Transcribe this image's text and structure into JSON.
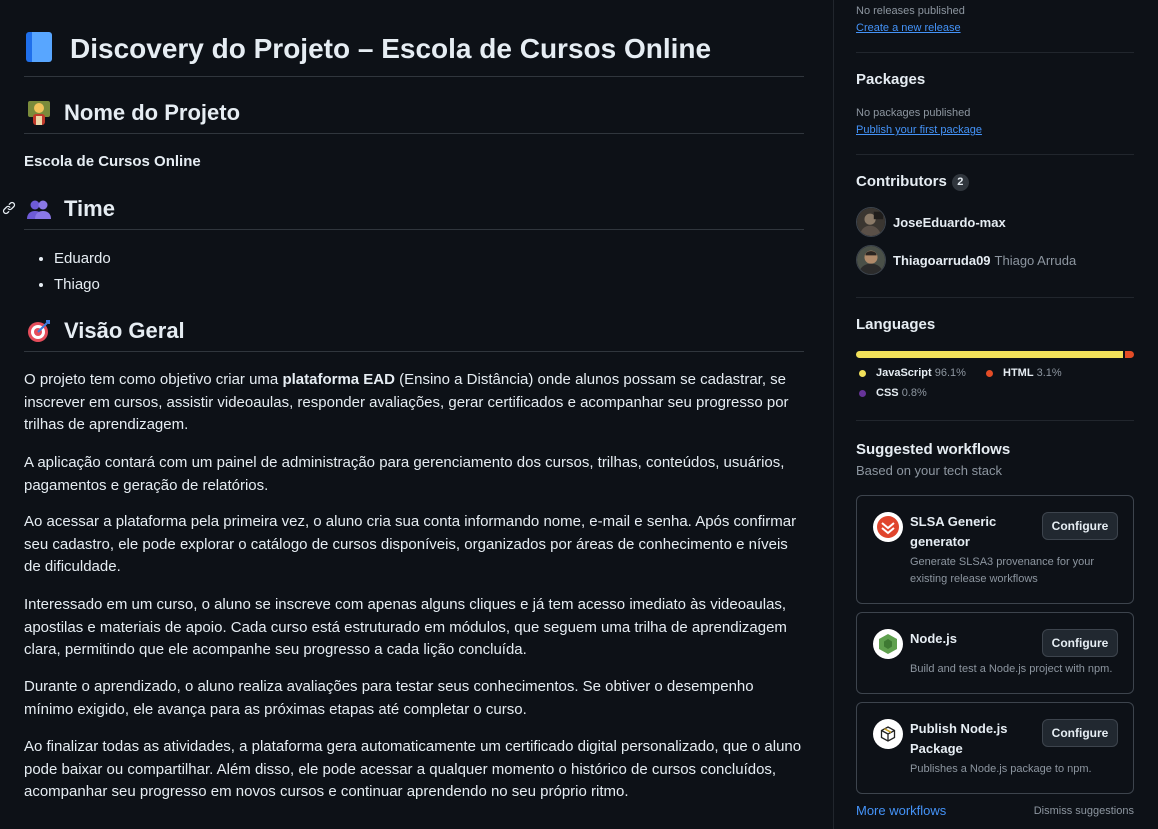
{
  "readme": {
    "title": "Discovery do Projeto – Escola de Cursos Online",
    "sections": {
      "nome": {
        "heading": "Nome do Projeto",
        "text": "Escola de Cursos Online"
      },
      "time": {
        "heading": "Time",
        "members": [
          "Eduardo",
          "Thiago"
        ]
      },
      "visao": {
        "heading": "Visão Geral"
      }
    },
    "p1": {
      "before": "O projeto tem como objetivo criar uma ",
      "bold": "plataforma EAD",
      "after": " (Ensino a Distância) onde alunos possam se cadastrar, se inscrever em cursos, assistir videoaulas, responder avaliações, gerar certificados e acompanhar seu progresso por trilhas de aprendizagem."
    },
    "paragraphs": [
      "A aplicação contará com um painel de administração para gerenciamento dos cursos, trilhas, conteúdos, usuários, pagamentos e geração de relatórios.",
      "Ao acessar a plataforma pela primeira vez, o aluno cria sua conta informando nome, e-mail e senha. Após confirmar seu cadastro, ele pode explorar o catálogo de cursos disponíveis, organizados por áreas de conhecimento e níveis de dificuldade.",
      "Interessado em um curso, o aluno se inscreve com apenas alguns cliques e já tem acesso imediato às videoaulas, apostilas e materiais de apoio. Cada curso está estruturado em módulos, que seguem uma trilha de aprendizagem clara, permitindo que ele acompanhe seu progresso a cada lição concluída.",
      "Durante o aprendizado, o aluno realiza avaliações para testar seus conhecimentos. Se obtiver o desempenho mínimo exigido, ele avança para as próximas etapas até completar o curso.",
      "Ao finalizar todas as atividades, a plataforma gera automaticamente um certificado digital personalizado, que o aluno pode baixar ou compartilhar. Além disso, ele pode acessar a qualquer momento o histórico de cursos concluídos, acompanhar seu progresso em novos cursos e continuar aprendendo no seu próprio ritmo."
    ]
  },
  "sidebar": {
    "releases": {
      "status": "No releases published",
      "link": "Create a new release"
    },
    "packages": {
      "heading": "Packages",
      "status": "No packages published",
      "link": "Publish your first package"
    },
    "contributors": {
      "heading": "Contributors",
      "count": "2",
      "people": [
        {
          "login": "JoseEduardo-max",
          "name": ""
        },
        {
          "login": "Thiagoarruda09",
          "name": "Thiago Arruda"
        }
      ]
    },
    "languages": {
      "heading": "Languages",
      "items": [
        {
          "name": "JavaScript",
          "percent": "96.1%",
          "value": 96.1,
          "color": "#f1e05a"
        },
        {
          "name": "HTML",
          "percent": "3.1%",
          "value": 3.1,
          "color": "#e34c26"
        },
        {
          "name": "CSS",
          "percent": "0.8%",
          "value": 0.8,
          "color": "#663399"
        }
      ]
    },
    "workflows": {
      "heading": "Suggested workflows",
      "subheading": "Based on your tech stack",
      "configure_label": "Configure",
      "cards": [
        {
          "title": "SLSA Generic generator",
          "desc": "Generate SLSA3 provenance for your existing release workflows",
          "icon": "slsa-icon"
        },
        {
          "title": "Node.js",
          "desc": "Build and test a Node.js project with npm.",
          "icon": "nodejs-icon"
        },
        {
          "title": "Publish Node.js Package",
          "desc": "Publishes a Node.js package to npm.",
          "icon": "package-icon"
        }
      ],
      "more_link": "More workflows",
      "dismiss": "Dismiss suggestions"
    }
  }
}
